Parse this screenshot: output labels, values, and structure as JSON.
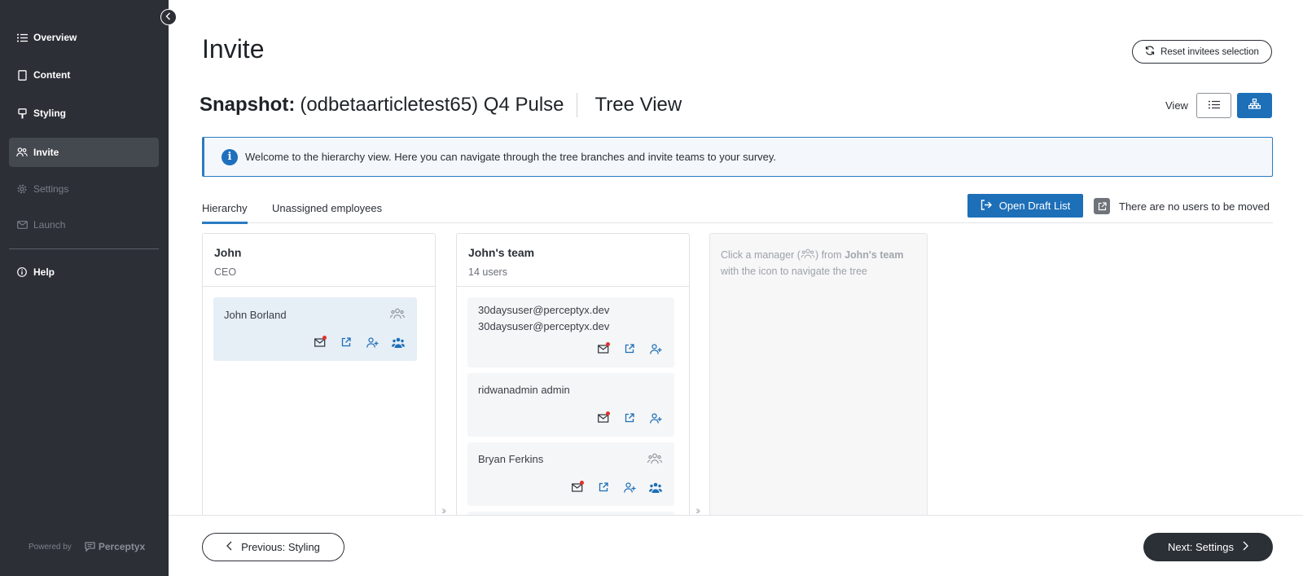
{
  "sidebar": {
    "items": [
      {
        "label": "Overview",
        "icon": "list-icon",
        "state": "normal"
      },
      {
        "label": "Content",
        "icon": "document-icon",
        "state": "normal"
      },
      {
        "label": "Styling",
        "icon": "paint-brush-icon",
        "state": "normal"
      },
      {
        "label": "Invite",
        "icon": "users-icon",
        "state": "active"
      },
      {
        "label": "Settings",
        "icon": "gear-icon",
        "state": "disabled"
      },
      {
        "label": "Launch",
        "icon": "envelope-icon",
        "state": "disabled"
      },
      {
        "label": "Help",
        "icon": "info-icon",
        "state": "normal"
      }
    ],
    "powered_by": "Powered by",
    "brand": "Perceptyx"
  },
  "header": {
    "title": "Invite",
    "reset_label": "Reset invitees selection"
  },
  "snapshot": {
    "label": "Snapshot:",
    "name": "(odbetaarticletest65) Q4 Pulse",
    "view_name": "Tree View"
  },
  "view": {
    "label": "View",
    "selected": "tree"
  },
  "banner": {
    "text": "Welcome to the hierarchy view. Here you can navigate through the tree branches and invite teams to your survey."
  },
  "tabs": [
    {
      "label": "Hierarchy",
      "active": true
    },
    {
      "label": "Unassigned employees",
      "active": false
    }
  ],
  "draft": {
    "button_label": "Open Draft List",
    "status": "There are no users to be moved"
  },
  "columns": [
    {
      "title": "John",
      "subtitle": "CEO",
      "cards": [
        {
          "name": "John Borland",
          "has_team": true,
          "selected": true
        }
      ]
    },
    {
      "title": "John's team",
      "subtitle": "14 users",
      "cards": [
        {
          "name": "30daysuser@perceptyx.dev",
          "name2": "30daysuser@perceptyx.dev",
          "has_team": false
        },
        {
          "name": "ridwanadmin admin",
          "has_team": false
        },
        {
          "name": "Bryan Ferkins",
          "has_team": true
        }
      ]
    }
  ],
  "placeholder": {
    "text_before": "Click a manager (",
    "text_middle": ") from ",
    "team": "John's team",
    "text_after": "with the icon to navigate the tree"
  },
  "footer": {
    "prev_label": "Previous: Styling",
    "next_label": "Next: Settings"
  },
  "colors": {
    "sidebar_bg": "#2c2f36",
    "accent": "#1d6fb8",
    "notification": "#e0322b"
  }
}
